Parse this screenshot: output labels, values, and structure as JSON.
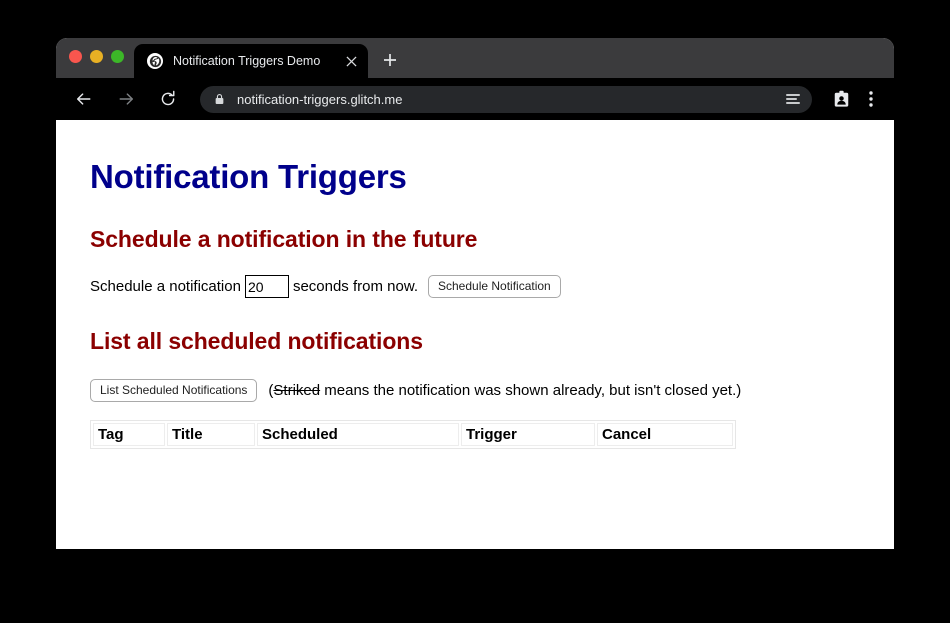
{
  "browser": {
    "window_controls": [
      {
        "name": "close",
        "color": "#f9564e"
      },
      {
        "name": "minimize",
        "color": "#e8b024"
      },
      {
        "name": "maximize",
        "color": "#3cb728"
      }
    ],
    "tab": {
      "title": "Notification Triggers Demo",
      "favicon": "globe-icon",
      "close_label": "×"
    },
    "new_tab_label": "+",
    "toolbar": {
      "back_icon": "back-arrow-icon",
      "forward_icon": "forward-arrow-icon",
      "reload_icon": "reload-icon",
      "lock_icon": "lock-icon",
      "url": "notification-triggers.glitch.me",
      "omnibox_actions_icon": "omnibox-menu-icon",
      "profile_icon": "profile-card-icon",
      "menu_icon": "three-dot-menu-icon"
    }
  },
  "page": {
    "title": "Notification Triggers",
    "schedule_section": {
      "heading": "Schedule a notification in the future",
      "text_before": "Schedule a notification",
      "seconds_value": "20",
      "text_after": "seconds from now.",
      "button_label": "Schedule Notification"
    },
    "list_section": {
      "heading": "List all scheduled notifications",
      "button_label": "List Scheduled Notifications",
      "hint_prefix": "(",
      "hint_striked": "Striked",
      "hint_suffix": " means the notification was shown already, but isn't closed yet.)"
    },
    "table": {
      "headers": [
        "Tag",
        "Title",
        "Scheduled",
        "Trigger",
        "Cancel"
      ],
      "rows": []
    }
  },
  "colors": {
    "title": "#00008b",
    "heading": "#8b0000",
    "page_background": "#ffffff",
    "chrome_tabstrip": "#3b3b3d",
    "chrome_toolbar": "#000000",
    "omnibox": "#26282b"
  }
}
